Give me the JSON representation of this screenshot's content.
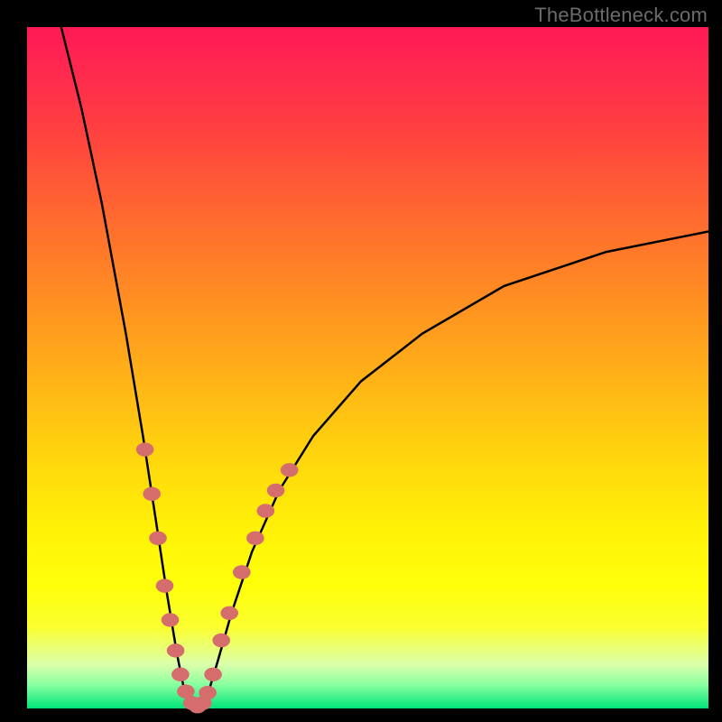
{
  "watermark": "TheBottleneck.com",
  "chart_data": {
    "type": "line",
    "title": "",
    "xlabel": "",
    "ylabel": "",
    "xlim": [
      0,
      100
    ],
    "ylim": [
      0,
      100
    ],
    "grid": false,
    "legend": false,
    "notes": "V-shaped bottleneck curve over rainbow heat gradient. Y represents percentage bottleneck (top=100% red, bottom=0% green). X represents component performance ratio (sweet spot at valley).",
    "series": [
      {
        "name": "left-branch",
        "x": [
          5,
          8,
          11,
          14.5,
          17,
          19,
          20.5,
          22,
          23,
          24,
          25
        ],
        "y": [
          100,
          88,
          74,
          55,
          40,
          27,
          17,
          8,
          3,
          1,
          0
        ]
      },
      {
        "name": "right-branch",
        "x": [
          25,
          26.5,
          28,
          30,
          33,
          37,
          42,
          49,
          58,
          70,
          85,
          100
        ],
        "y": [
          0,
          2,
          7,
          14,
          23,
          32,
          40,
          48,
          55,
          62,
          67,
          70
        ]
      }
    ],
    "markers": {
      "name": "sample-points",
      "color": "#d66d6d",
      "points": [
        {
          "x": 17.3,
          "y": 38
        },
        {
          "x": 18.3,
          "y": 31.5
        },
        {
          "x": 19.2,
          "y": 25
        },
        {
          "x": 20.2,
          "y": 18
        },
        {
          "x": 21.0,
          "y": 13
        },
        {
          "x": 21.8,
          "y": 8.5
        },
        {
          "x": 22.5,
          "y": 5
        },
        {
          "x": 23.3,
          "y": 2.5
        },
        {
          "x": 24.2,
          "y": 0.8
        },
        {
          "x": 25.0,
          "y": 0.3
        },
        {
          "x": 25.8,
          "y": 0.8
        },
        {
          "x": 26.5,
          "y": 2.3
        },
        {
          "x": 27.3,
          "y": 5
        },
        {
          "x": 28.5,
          "y": 10
        },
        {
          "x": 29.7,
          "y": 14
        },
        {
          "x": 31.5,
          "y": 20
        },
        {
          "x": 33.5,
          "y": 25
        },
        {
          "x": 35.0,
          "y": 29
        },
        {
          "x": 36.5,
          "y": 32
        },
        {
          "x": 38.5,
          "y": 35
        }
      ]
    }
  }
}
